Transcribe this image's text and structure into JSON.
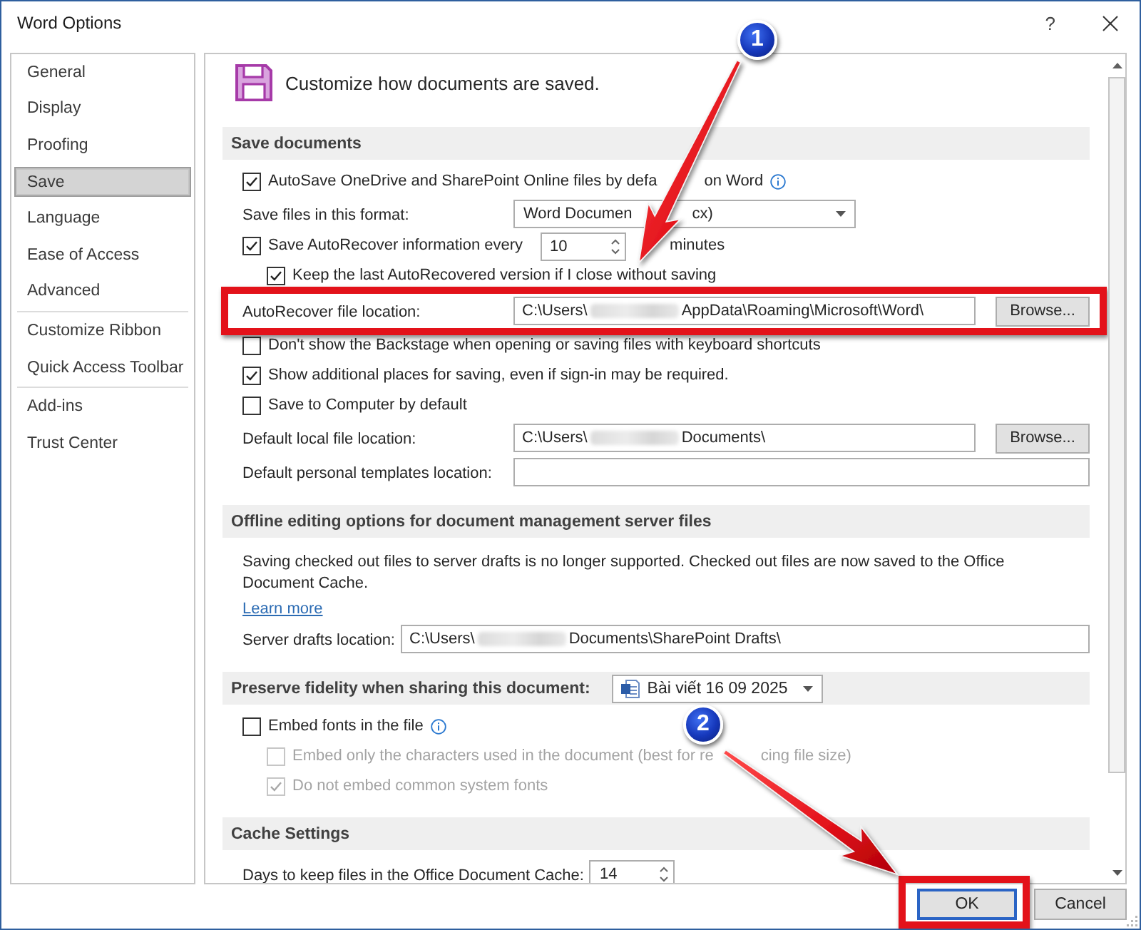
{
  "window": {
    "title": "Word Options",
    "help": "?"
  },
  "sidebar": {
    "groups": [
      {
        "items": [
          {
            "label": "General",
            "selected": false
          },
          {
            "label": "Display",
            "selected": false
          },
          {
            "label": "Proofing",
            "selected": false
          },
          {
            "label": "Save",
            "selected": true
          },
          {
            "label": "Language",
            "selected": false
          },
          {
            "label": "Ease of Access",
            "selected": false
          },
          {
            "label": "Advanced",
            "selected": false
          }
        ]
      },
      {
        "items": [
          {
            "label": "Customize Ribbon",
            "selected": false
          },
          {
            "label": "Quick Access Toolbar",
            "selected": false
          }
        ]
      },
      {
        "items": [
          {
            "label": "Add-ins",
            "selected": false
          },
          {
            "label": "Trust Center",
            "selected": false
          }
        ]
      }
    ]
  },
  "page": {
    "heading": "Customize how documents are saved."
  },
  "sections": [
    {
      "title": "Save documents",
      "rows": [
        {
          "kind": "checkbox",
          "checked": true,
          "disabled": false,
          "parts": [
            "AutoSave OneDrive and SharePoint Online files by defa",
            "on Word"
          ],
          "info": true
        },
        {
          "kind": "dropdown",
          "label": "Save files in this format:",
          "value_parts": [
            "Word Documen",
            "cx)"
          ]
        },
        {
          "kind": "checkbox_spin",
          "checked": true,
          "disabled": false,
          "parts": [
            "Save AutoRecover information every"
          ],
          "value": "10",
          "unit": "minutes",
          "children": [
            {
              "kind": "checkbox",
              "checked": true,
              "disabled": false,
              "parts": [
                "Keep the last AutoRecovered version if I close without saving"
              ]
            }
          ]
        },
        {
          "kind": "path",
          "label": "AutoRecover file location:",
          "segments": [
            {
              "kind": "text",
              "text": "C:\\Users\\"
            },
            {
              "kind": "blur"
            },
            {
              "kind": "text",
              "text": "AppData\\Roaming\\Microsoft\\Word\\"
            }
          ],
          "button": "Browse...",
          "highlighted": true
        },
        {
          "kind": "checkbox",
          "checked": false,
          "disabled": false,
          "parts": [
            "Don't show the Backstage when opening or saving files with keyboard shortcuts"
          ]
        },
        {
          "kind": "checkbox",
          "checked": true,
          "disabled": false,
          "parts": [
            "Show additional places for saving, even if sign-in may be required."
          ]
        },
        {
          "kind": "checkbox",
          "checked": false,
          "disabled": false,
          "parts": [
            "Save to Computer by default"
          ]
        },
        {
          "kind": "path",
          "label": "Default local file location:",
          "segments": [
            {
              "kind": "text",
              "text": "C:\\Users\\"
            },
            {
              "kind": "blur"
            },
            {
              "kind": "text",
              "text": "Documents\\"
            }
          ],
          "button": "Browse..."
        },
        {
          "kind": "path",
          "label": "Default personal templates location:"
        }
      ]
    },
    {
      "title": "Offline editing options for document management server files",
      "rows": [
        {
          "kind": "paragraph",
          "text": "Saving checked out files to server drafts is no longer supported. Checked out files are now saved to the Office Document Cache."
        },
        {
          "kind": "link",
          "text": "Learn more"
        },
        {
          "kind": "path",
          "label": "Server drafts location:",
          "segments": [
            {
              "kind": "text",
              "text": "C:\\Users\\"
            },
            {
              "kind": "blur"
            },
            {
              "kind": "text",
              "text": "Documents\\SharePoint Drafts\\"
            }
          ]
        }
      ]
    },
    {
      "title": "Preserve fidelity when sharing this document:",
      "document": {
        "name": "Bài viết 16 09 2025"
      },
      "rows": [
        {
          "kind": "checkbox",
          "checked": false,
          "disabled": false,
          "parts": [
            "Embed fonts in the file"
          ],
          "info": true,
          "children": [
            {
              "kind": "checkbox",
              "checked": false,
              "disabled": true,
              "parts": [
                "Embed only the characters used in the document (best for re",
                "cing file size)"
              ]
            },
            {
              "kind": "checkbox",
              "checked": true,
              "disabled": true,
              "parts": [
                "Do not embed common system fonts"
              ]
            }
          ]
        }
      ]
    },
    {
      "title": "Cache Settings",
      "rows": [
        {
          "kind": "spin",
          "label": "Days to keep files in the Office Document Cache:",
          "value": "14"
        }
      ]
    }
  ],
  "buttons": [
    {
      "label": "OK",
      "default": true,
      "highlighted": true
    },
    {
      "label": "Cancel",
      "default": false
    }
  ],
  "annotations": [
    {
      "number": "1"
    },
    {
      "number": "2"
    }
  ]
}
